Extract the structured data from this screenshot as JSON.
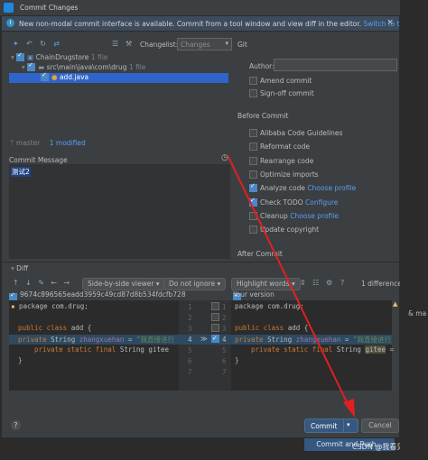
{
  "window": {
    "title": "Commit Changes",
    "close_glyph": "×"
  },
  "banner": {
    "text": "New non-modal commit interface is available. Commit from a tool window and view diff in the editor.",
    "link": "Switch to tool window",
    "close_glyph": "×"
  },
  "toolbar": {
    "changelist_label": "Changelist:",
    "changelist_value": "Changes",
    "git_label": "Git"
  },
  "tree": {
    "root": {
      "label": "ChainDrugstore",
      "meta": "1 file"
    },
    "folder": {
      "label": "src\\main\\java\\com\\drug",
      "meta": "1 file"
    },
    "file": {
      "label": "add.java"
    }
  },
  "branch": {
    "name": "master",
    "status": "1 modified"
  },
  "git_panel": {
    "author_label": "Author:",
    "amend_label": "Amend commit",
    "signoff_label": "Sign-off commit",
    "before_commit_label": "Before Commit",
    "options": [
      {
        "label": "Alibaba Code Guidelines",
        "checked": false,
        "link": ""
      },
      {
        "label": "Reformat code",
        "checked": false,
        "link": ""
      },
      {
        "label": "Rearrange code",
        "checked": false,
        "link": ""
      },
      {
        "label": "Optimize imports",
        "checked": false,
        "link": ""
      },
      {
        "label": "Analyze code",
        "checked": true,
        "link": "Choose profile"
      },
      {
        "label": "Check TODO",
        "checked": true,
        "link": "Configure"
      },
      {
        "label": "Cleanup",
        "checked": false,
        "link": "Choose profile"
      },
      {
        "label": "Update copyright",
        "checked": false,
        "link": ""
      }
    ],
    "after_commit_label": "After Commit"
  },
  "commit_message": {
    "label": "Commit Message",
    "text": "测试2"
  },
  "diff": {
    "label": "Diff",
    "viewer": "Side-by-side viewer",
    "ignore": "Do not ignore",
    "highlight": "Highlight words",
    "diff_count": "1 difference",
    "left_header": "9674c896565eadd3959c49cd87d8b534fdcfb728",
    "right_header": "Your version",
    "left_lines": [
      {
        "num": "1",
        "text": "package com.drug;"
      },
      {
        "num": "2",
        "text": ""
      },
      {
        "num": "3",
        "text": "public class add {"
      },
      {
        "num": "4",
        "text": "private String zhangxuehan = \"我直接进行"
      },
      {
        "num": "5",
        "text": "    private static final String gitee"
      },
      {
        "num": "6",
        "text": "}"
      },
      {
        "num": "7",
        "text": ""
      }
    ],
    "right_lines": [
      {
        "num": "1",
        "text": "package com.drug;"
      },
      {
        "num": "2",
        "text": ""
      },
      {
        "num": "3",
        "text": "public class add {"
      },
      {
        "num": "4",
        "text": "private String zhangxuehan = \"我直接进行"
      },
      {
        "num": "5",
        "text": "    private static final String gitee ="
      },
      {
        "num": "6",
        "text": "}"
      },
      {
        "num": "7",
        "text": ""
      }
    ]
  },
  "footer": {
    "help": "?",
    "commit": "Commit",
    "cancel": "Cancel",
    "commit_and_push": "Commit and Push..."
  },
  "watermark": "CSDN @我看见先了",
  "side_text": "& ma",
  "colors": {
    "accent": "#589df6",
    "selection": "#2f65ca",
    "commit_button": "#365880",
    "arrow": "#e02020"
  }
}
